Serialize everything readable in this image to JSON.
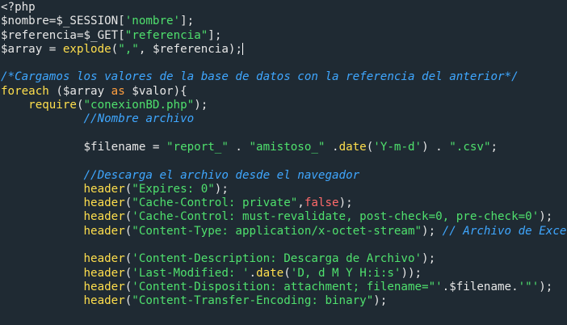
{
  "editor": {
    "colors": {
      "background": "#1f2a33",
      "plain": "#e6e6e6",
      "string": "#4fe06d",
      "function": "#ffdf4d",
      "keyword": "#ff9f40",
      "comment": "#3fa7ff",
      "constant": "#ff6a6a"
    },
    "caret_after_line": 3,
    "lines": [
      [
        {
          "t": "<?php",
          "k": "tag"
        }
      ],
      [
        {
          "t": "$nombre",
          "k": "var"
        },
        {
          "t": "=",
          "k": "plain"
        },
        {
          "t": "$_SESSION",
          "k": "var"
        },
        {
          "t": "[",
          "k": "plain"
        },
        {
          "t": "'nombre'",
          "k": "str"
        },
        {
          "t": "];",
          "k": "plain"
        }
      ],
      [
        {
          "t": "$referencia",
          "k": "var"
        },
        {
          "t": "=",
          "k": "plain"
        },
        {
          "t": "$_GET",
          "k": "var"
        },
        {
          "t": "[",
          "k": "plain"
        },
        {
          "t": "\"referencia\"",
          "k": "str"
        },
        {
          "t": "];",
          "k": "plain"
        }
      ],
      [
        {
          "t": "$array",
          "k": "var"
        },
        {
          "t": " = ",
          "k": "plain"
        },
        {
          "t": "explode",
          "k": "func"
        },
        {
          "t": "(",
          "k": "plain"
        },
        {
          "t": "\",\"",
          "k": "str"
        },
        {
          "t": ", ",
          "k": "plain"
        },
        {
          "t": "$referencia",
          "k": "var"
        },
        {
          "t": ");",
          "k": "plain"
        }
      ],
      [],
      [
        {
          "t": "/*Cargamos los valores de la base de datos con la referencia del anterior*/",
          "k": "comment"
        }
      ],
      [
        {
          "t": "foreach",
          "k": "func"
        },
        {
          "t": " (",
          "k": "plain"
        },
        {
          "t": "$array",
          "k": "var"
        },
        {
          "t": " as ",
          "k": "kw"
        },
        {
          "t": "$valor",
          "k": "var"
        },
        {
          "t": "){",
          "k": "plain"
        }
      ],
      [
        {
          "t": "    ",
          "k": "plain"
        },
        {
          "t": "require",
          "k": "func"
        },
        {
          "t": "(",
          "k": "plain"
        },
        {
          "t": "\"conexionBD.php\"",
          "k": "str"
        },
        {
          "t": ");",
          "k": "plain"
        }
      ],
      [
        {
          "t": "            ",
          "k": "plain"
        },
        {
          "t": "//Nombre archivo",
          "k": "comment"
        }
      ],
      [],
      [
        {
          "t": "            ",
          "k": "plain"
        },
        {
          "t": "$filename",
          "k": "var"
        },
        {
          "t": " = ",
          "k": "plain"
        },
        {
          "t": "\"report_\"",
          "k": "str"
        },
        {
          "t": " . ",
          "k": "plain"
        },
        {
          "t": "\"amistoso_\"",
          "k": "str"
        },
        {
          "t": " .",
          "k": "plain"
        },
        {
          "t": "date",
          "k": "func"
        },
        {
          "t": "(",
          "k": "plain"
        },
        {
          "t": "'Y-m-d'",
          "k": "str"
        },
        {
          "t": ") . ",
          "k": "plain"
        },
        {
          "t": "\".csv\"",
          "k": "str"
        },
        {
          "t": ";",
          "k": "plain"
        }
      ],
      [],
      [
        {
          "t": "            ",
          "k": "plain"
        },
        {
          "t": "//Descarga el archivo desde el navegador",
          "k": "comment"
        }
      ],
      [
        {
          "t": "            ",
          "k": "plain"
        },
        {
          "t": "header",
          "k": "func"
        },
        {
          "t": "(",
          "k": "plain"
        },
        {
          "t": "\"Expires: 0\"",
          "k": "str"
        },
        {
          "t": ");",
          "k": "plain"
        }
      ],
      [
        {
          "t": "            ",
          "k": "plain"
        },
        {
          "t": "header",
          "k": "func"
        },
        {
          "t": "(",
          "k": "plain"
        },
        {
          "t": "\"Cache-Control: private\"",
          "k": "str"
        },
        {
          "t": ",",
          "k": "plain"
        },
        {
          "t": "false",
          "k": "const"
        },
        {
          "t": ");",
          "k": "plain"
        }
      ],
      [
        {
          "t": "            ",
          "k": "plain"
        },
        {
          "t": "header",
          "k": "func"
        },
        {
          "t": "(",
          "k": "plain"
        },
        {
          "t": "'Cache-Control: must-revalidate, post-check=0, pre-check=0'",
          "k": "str"
        },
        {
          "t": ");",
          "k": "plain"
        }
      ],
      [
        {
          "t": "            ",
          "k": "plain"
        },
        {
          "t": "header",
          "k": "func"
        },
        {
          "t": "(",
          "k": "plain"
        },
        {
          "t": "\"Content-Type: application/x-octet-stream\"",
          "k": "str"
        },
        {
          "t": "); ",
          "k": "plain"
        },
        {
          "t": "// Archivo de Excel",
          "k": "comment"
        }
      ],
      [],
      [
        {
          "t": "            ",
          "k": "plain"
        },
        {
          "t": "header",
          "k": "func"
        },
        {
          "t": "(",
          "k": "plain"
        },
        {
          "t": "'Content-Description: Descarga de Archivo'",
          "k": "str"
        },
        {
          "t": ");",
          "k": "plain"
        }
      ],
      [
        {
          "t": "            ",
          "k": "plain"
        },
        {
          "t": "header",
          "k": "func"
        },
        {
          "t": "(",
          "k": "plain"
        },
        {
          "t": "'Last-Modified: '",
          "k": "str"
        },
        {
          "t": ".",
          "k": "plain"
        },
        {
          "t": "date",
          "k": "func"
        },
        {
          "t": "(",
          "k": "plain"
        },
        {
          "t": "'D, d M Y H:i:s'",
          "k": "str"
        },
        {
          "t": "));",
          "k": "plain"
        }
      ],
      [
        {
          "t": "            ",
          "k": "plain"
        },
        {
          "t": "header",
          "k": "func"
        },
        {
          "t": "(",
          "k": "plain"
        },
        {
          "t": "'Content-Disposition: attachment; filename=\"'",
          "k": "str"
        },
        {
          "t": ".",
          "k": "plain"
        },
        {
          "t": "$filename",
          "k": "var"
        },
        {
          "t": ".",
          "k": "plain"
        },
        {
          "t": "'\"'",
          "k": "str"
        },
        {
          "t": ");",
          "k": "plain"
        }
      ],
      [
        {
          "t": "            ",
          "k": "plain"
        },
        {
          "t": "header",
          "k": "func"
        },
        {
          "t": "(",
          "k": "plain"
        },
        {
          "t": "\"Content-Transfer-Encoding: binary\"",
          "k": "str"
        },
        {
          "t": ");",
          "k": "plain"
        }
      ]
    ]
  }
}
